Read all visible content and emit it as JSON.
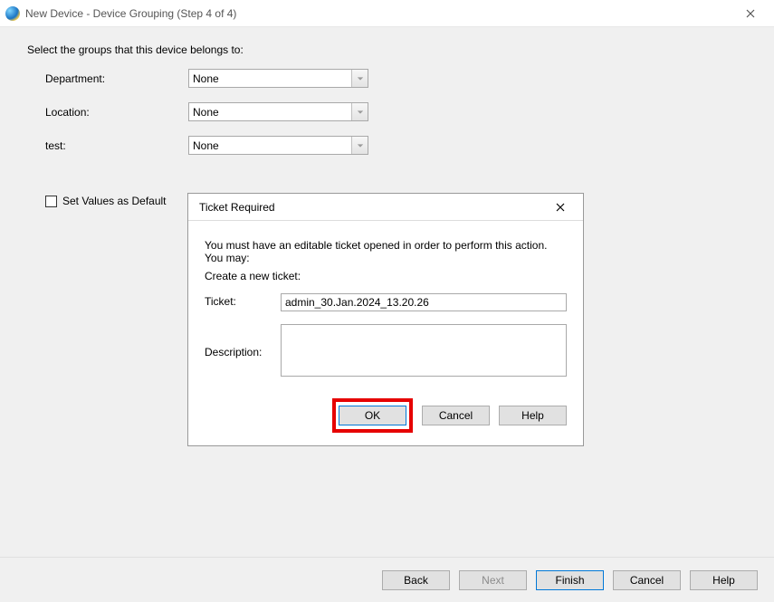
{
  "titlebar": {
    "title": "New Device - Device Grouping (Step 4 of 4)"
  },
  "main": {
    "instruction": "Select the groups that this device belongs to:",
    "fields": [
      {
        "label": "Department:",
        "value": "None"
      },
      {
        "label": "Location:",
        "value": "None"
      },
      {
        "label": "test:",
        "value": "None"
      }
    ],
    "default_checkbox_label": "Set Values as Default"
  },
  "footer": {
    "back": "Back",
    "next": "Next",
    "finish": "Finish",
    "cancel": "Cancel",
    "help": "Help"
  },
  "modal": {
    "title": "Ticket Required",
    "message": "You must have an editable ticket opened in order to perform this action. You may:",
    "create_label": "Create a new ticket:",
    "ticket_label": "Ticket:",
    "ticket_value": "admin_30.Jan.2024_13.20.26",
    "description_label": "Description:",
    "description_value": "",
    "buttons": {
      "ok": "OK",
      "cancel": "Cancel",
      "help": "Help"
    }
  }
}
